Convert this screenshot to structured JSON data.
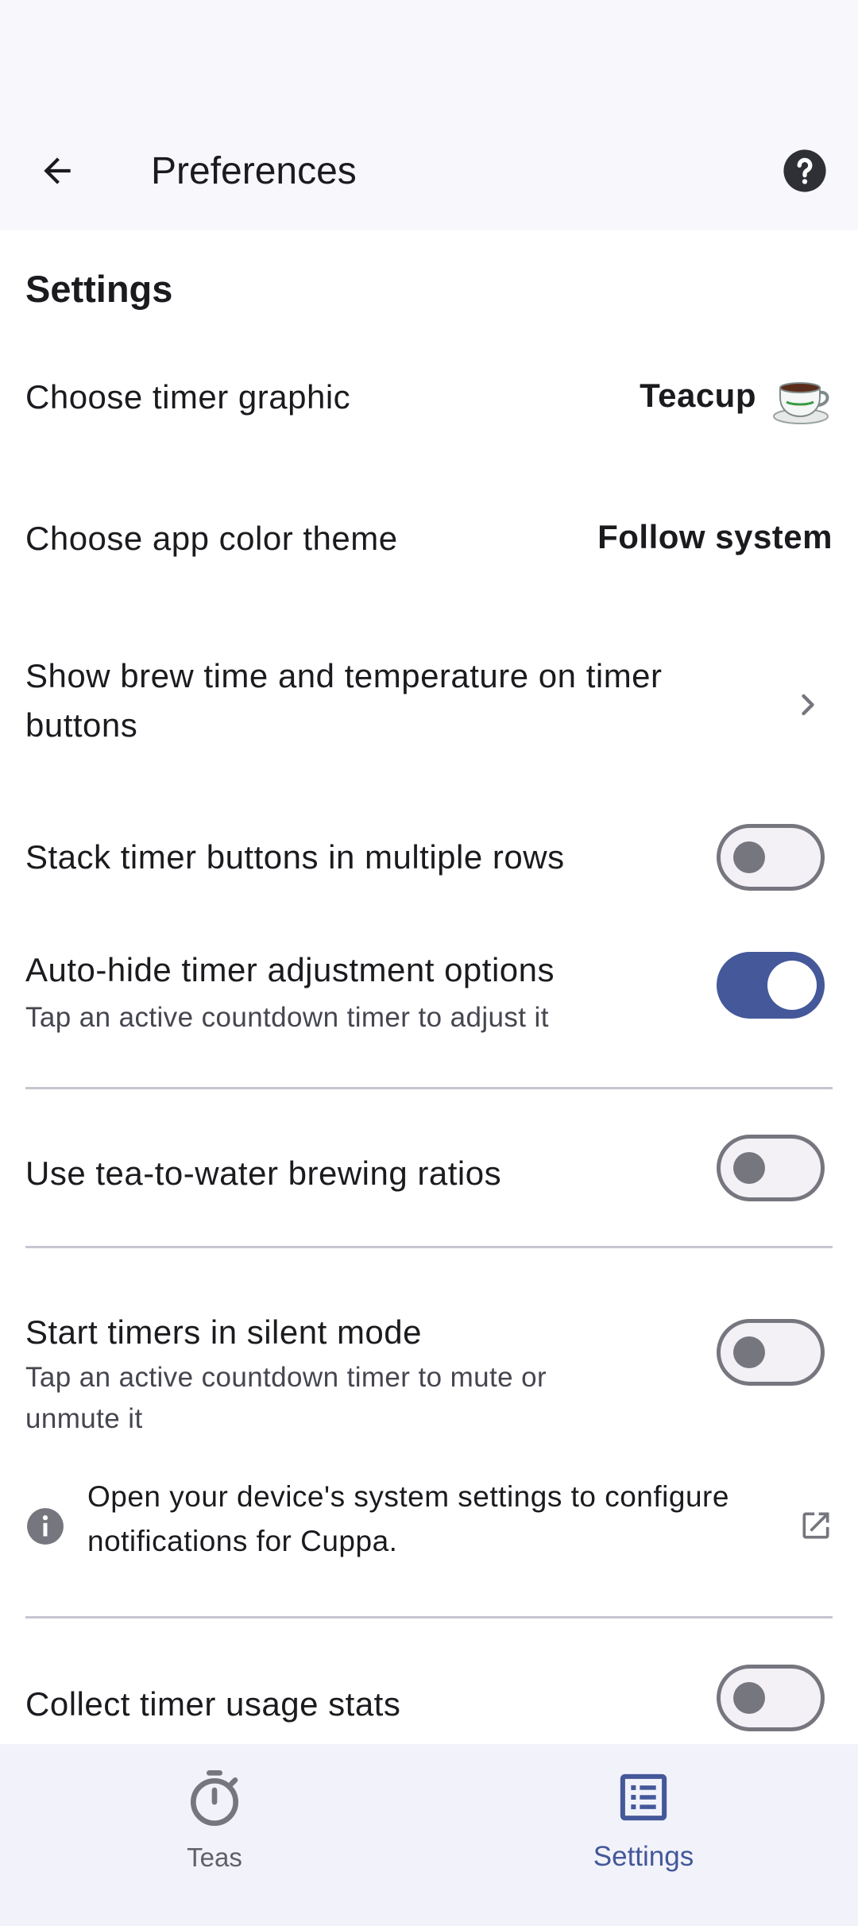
{
  "header": {
    "title": "Preferences"
  },
  "settings": {
    "section_title": "Settings",
    "timer_graphic": {
      "label": "Choose timer graphic",
      "value": "Teacup"
    },
    "color_theme": {
      "label": "Choose app color theme",
      "value": "Follow system"
    },
    "brew_time": {
      "label_line1": "Show brew time and temperature on timer",
      "label_line2": "buttons"
    },
    "stack_buttons": {
      "label": "Stack timer buttons in multiple rows",
      "enabled": false
    },
    "auto_hide": {
      "label": "Auto-hide timer adjustment options",
      "sub": "Tap an active countdown timer to adjust it",
      "enabled": true
    },
    "ratios": {
      "label": "Use tea-to-water brewing ratios",
      "enabled": false
    },
    "silent_mode": {
      "label": "Start timers in silent mode",
      "sub_line1": "Tap an active countdown timer to mute or",
      "sub_line2": "unmute it",
      "enabled": false
    },
    "notifications": {
      "line1": "Open your device's system settings to configure",
      "line2": "notifications for Cuppa."
    },
    "usage_stats": {
      "label": "Collect timer usage stats",
      "enabled": false
    }
  },
  "nav": {
    "teas_label": "Teas",
    "settings_label": "Settings"
  },
  "colors": {
    "accent": "#44589a",
    "switch_off_border": "#76767f",
    "nav_background": "#f2f3fa"
  }
}
